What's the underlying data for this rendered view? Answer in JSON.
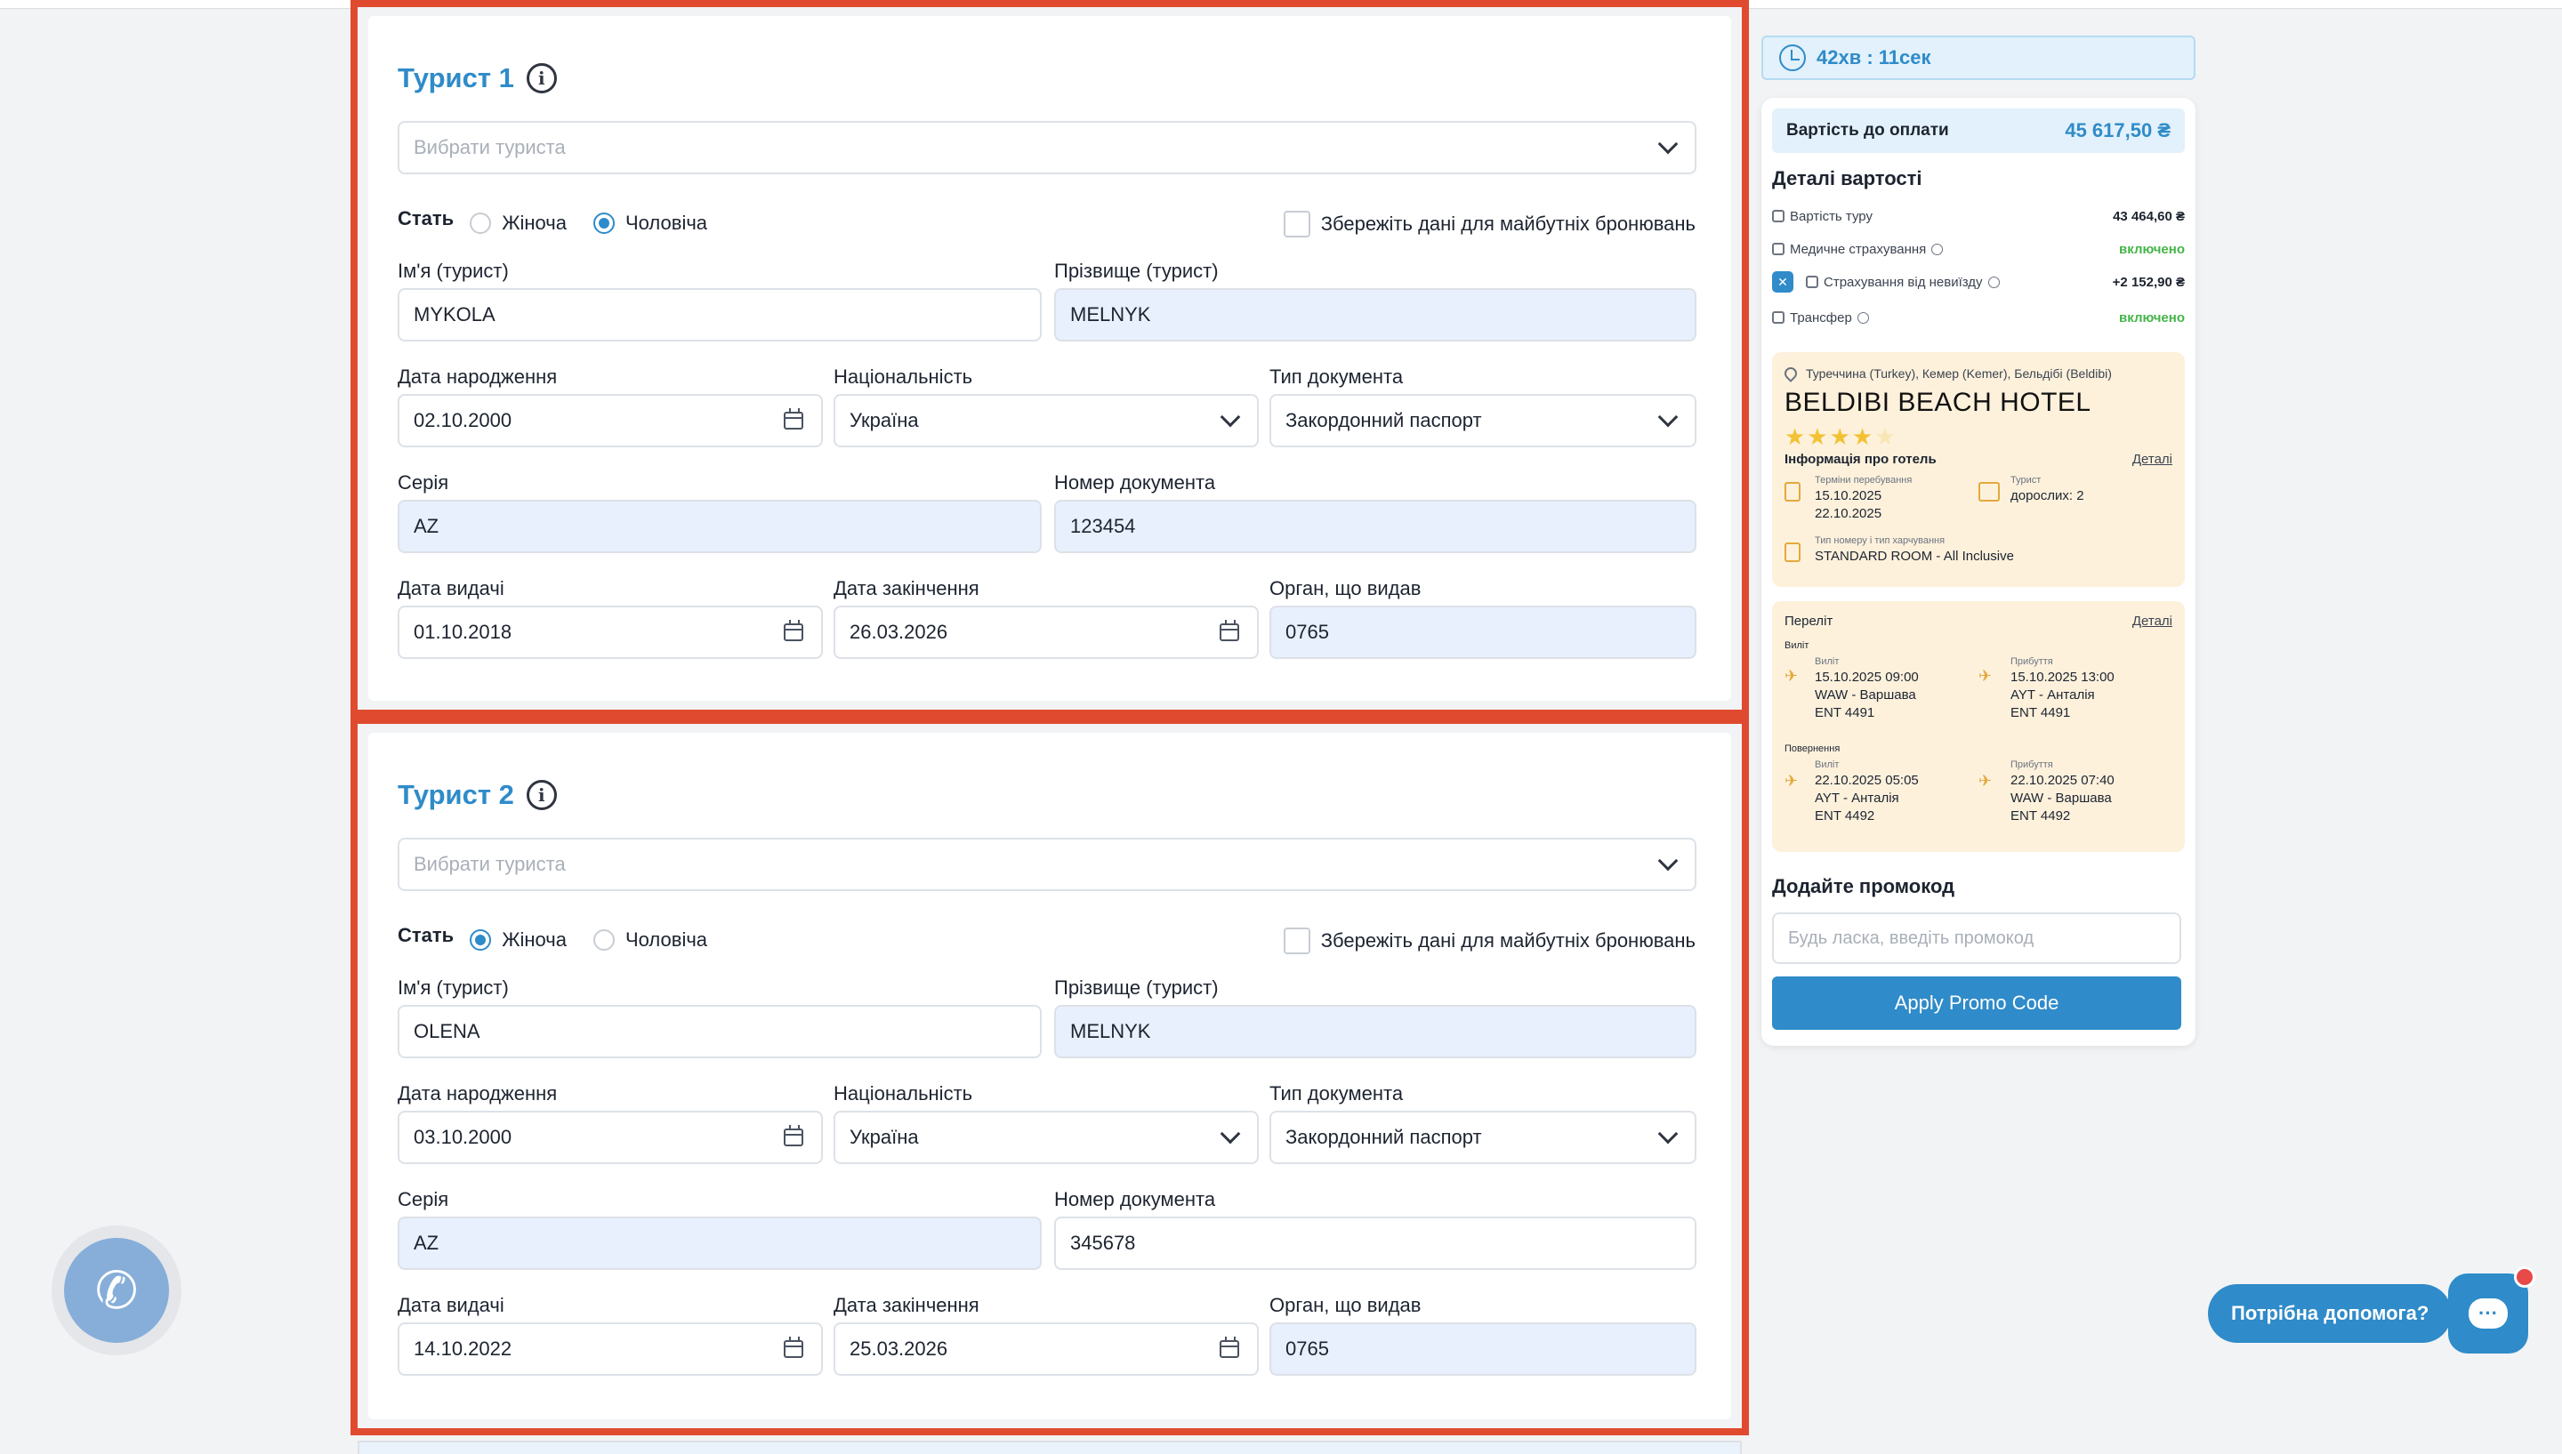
{
  "tourists": [
    {
      "title": "Турист 1",
      "select_placeholder": "Вибрати туриста",
      "gender_label": "Стать",
      "gender_female": "Жіноча",
      "gender_male": "Чоловіча",
      "gender_selected": "male",
      "save_label": "Збережіть дані для майбутніх бронювань",
      "first_name_label": "Ім'я (турист)",
      "first_name": "MYKOLA",
      "last_name_label": "Прізвище (турист)",
      "last_name": "MELNYK",
      "dob_label": "Дата народження",
      "dob": "02.10.2000",
      "nationality_label": "Національність",
      "nationality": "Україна",
      "doc_type_label": "Тип документа",
      "doc_type": "Закордонний паспорт",
      "series_label": "Серія",
      "series": "AZ",
      "doc_number_label": "Номер документа",
      "doc_number": "123454",
      "issue_date_label": "Дата видачі",
      "issue_date": "01.10.2018",
      "expiry_label": "Дата закінчення",
      "expiry": "26.03.2026",
      "authority_label": "Орган, що видав",
      "authority": "0765"
    },
    {
      "title": "Турист 2",
      "select_placeholder": "Вибрати туриста",
      "gender_label": "Стать",
      "gender_female": "Жіноча",
      "gender_male": "Чоловіча",
      "gender_selected": "female",
      "save_label": "Збережіть дані для майбутніх бронювань",
      "first_name_label": "Ім'я (турист)",
      "first_name": "OLENA",
      "last_name_label": "Прізвище (турист)",
      "last_name": "MELNYK",
      "dob_label": "Дата народження",
      "dob": "03.10.2000",
      "nationality_label": "Національність",
      "nationality": "Україна",
      "doc_type_label": "Тип документа",
      "doc_type": "Закордонний паспорт",
      "series_label": "Серія",
      "series": "AZ",
      "doc_number_label": "Номер документа",
      "doc_number": "345678",
      "issue_date_label": "Дата видачі",
      "issue_date": "14.10.2022",
      "expiry_label": "Дата закінчення",
      "expiry": "25.03.2026",
      "authority_label": "Орган, що видав",
      "authority": "0765"
    }
  ],
  "sidebar": {
    "timer": "42хв : 11сек",
    "total_label": "Вартість до оплати",
    "total_amount": "45 617,50 ₴",
    "details_title": "Деталі вартості",
    "cost_lines": [
      {
        "label": "Вартість туру",
        "value": "43 464,60 ₴"
      },
      {
        "label": "Медичне страхування",
        "value": "включено"
      },
      {
        "label": "Страхування від невиїзду",
        "value": "+2 152,90 ₴"
      },
      {
        "label": "Трансфер",
        "value": "включено"
      }
    ],
    "hotel": {
      "location": "Туреччина (Turkey), Кемер (Kemer), Бельдібі (Beldibi)",
      "name": "BELDIBI BEACH HOTEL",
      "stars": "★★★★",
      "star_off": "★",
      "info_label": "Інформація про готель",
      "details_link": "Деталі",
      "stay_label": "Терміни перебування",
      "stay_from": "15.10.2025",
      "stay_to": "22.10.2025",
      "tourist_label": "Турист",
      "tourist_value": "дорослих: 2",
      "room_label": "Тип номеру і тип харчування",
      "room_value": "STANDARD ROOM - All Inclusive"
    },
    "flight": {
      "title": "Переліт",
      "details_link": "Деталі",
      "depart_section": "Виліт",
      "return_section": "Повернення",
      "out_dep_label": "Виліт",
      "out_dep_time": "15.10.2025 09:00",
      "out_dep_route": "WAW - Варшава",
      "out_dep_flight": "ENT 4491",
      "out_arr_label": "Прибуття",
      "out_arr_time": "15.10.2025 13:00",
      "out_arr_route": "AYT - Анталія",
      "out_arr_flight": "ENT 4491",
      "ret_dep_label": "Виліт",
      "ret_dep_time": "22.10.2025 05:05",
      "ret_dep_route": "AYT - Анталія",
      "ret_dep_flight": "ENT 4492",
      "ret_arr_label": "Прибуття",
      "ret_arr_time": "22.10.2025 07:40",
      "ret_arr_route": "WAW - Варшава",
      "ret_arr_flight": "ENT 4492"
    },
    "promo_title": "Додайте промокод",
    "promo_placeholder": "Будь ласка, введіть промокод",
    "promo_button": "Apply Promo Code"
  },
  "help": {
    "bubble": "Потрібна допомога?"
  },
  "colors": {
    "accent": "#2f8bc9",
    "highlight_border": "#e04a2f",
    "filled_field": "#e8f0fd",
    "included": "#45b449",
    "hotel_card": "#fdf1dc"
  },
  "icons": [
    "info-icon",
    "chevron-down-icon",
    "calendar-icon",
    "timer-icon",
    "phone-icon",
    "chat-icon",
    "map-pin-icon",
    "plane-icon"
  ]
}
